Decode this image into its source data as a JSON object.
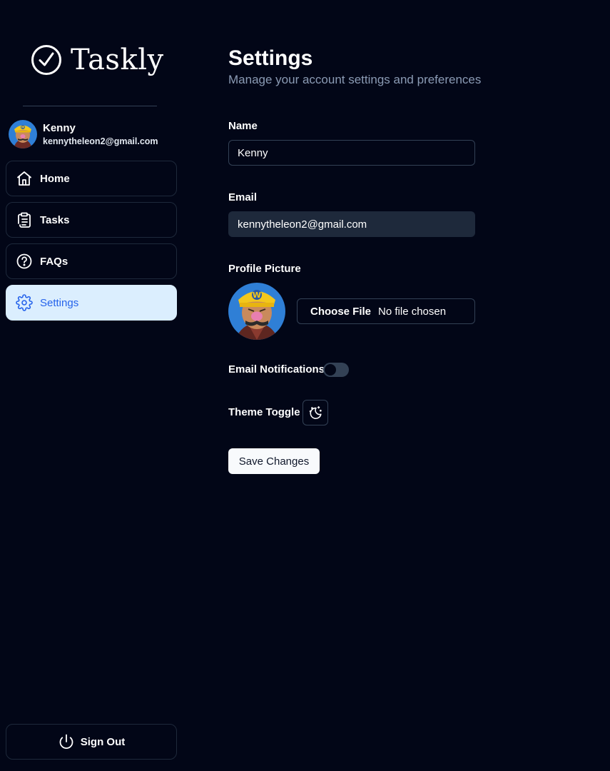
{
  "app": {
    "name": "Taskly",
    "accent_color": "#2563eb",
    "background_color": "#020617"
  },
  "user": {
    "name": "Kenny",
    "email": "kennytheleon2@gmail.com"
  },
  "sidebar": {
    "items": [
      {
        "label": "Home",
        "icon": "home-icon",
        "active": false
      },
      {
        "label": "Tasks",
        "icon": "clipboard-icon",
        "active": false
      },
      {
        "label": "FAQs",
        "icon": "help-circle-icon",
        "active": false
      },
      {
        "label": "Settings",
        "icon": "gear-icon",
        "active": true
      }
    ],
    "sign_out_label": "Sign Out"
  },
  "settings": {
    "title": "Settings",
    "subtitle": "Manage your account settings and preferences",
    "name_label": "Name",
    "name_value": "Kenny",
    "email_label": "Email",
    "email_value": "kennytheleon2@gmail.com",
    "profile_picture_label": "Profile Picture",
    "file_button_label": "Choose File",
    "file_status": "No file chosen",
    "email_notifications_label": "Email Notifications",
    "email_notifications_enabled": false,
    "theme_toggle_label": "Theme Toggle",
    "theme_icon": "moon-stars-icon",
    "save_label": "Save Changes"
  }
}
